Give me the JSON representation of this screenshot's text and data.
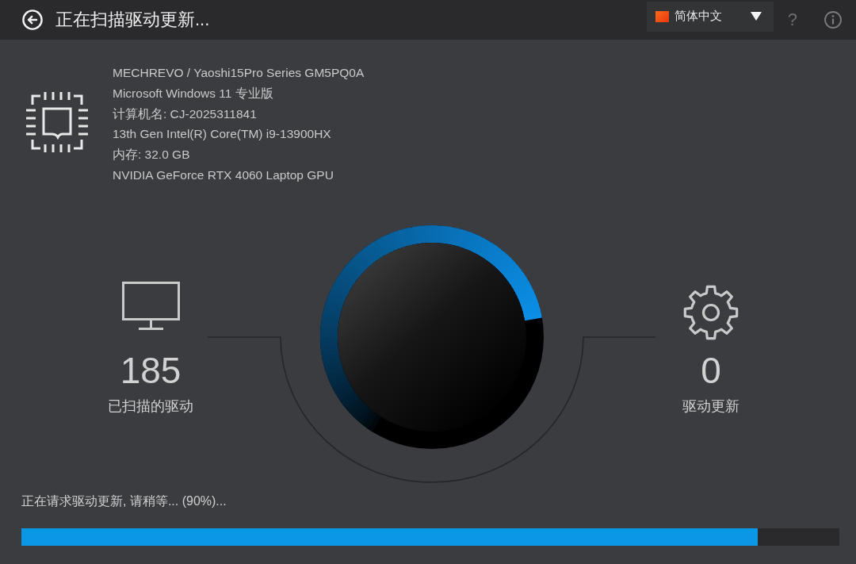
{
  "header": {
    "title": "正在扫描驱动更新...",
    "language": {
      "label": "简体中文"
    },
    "help": "?"
  },
  "system_info": {
    "model": "MECHREVO / Yaoshi15Pro Series GM5PQ0A",
    "os": "Microsoft Windows 11 专业版",
    "computer_name": "计算机名: CJ-2025311841",
    "processor": "13th Gen Intel(R) Core(TM) i9-13900HX",
    "memory": "内存: 32.0 GB",
    "graphics": "NVIDIA GeForce RTX 4060 Laptop GPU"
  },
  "stats": [
    {
      "kind": "scanned",
      "value": "185",
      "label": "已扫描的驱动"
    },
    {
      "kind": "updates",
      "value": "0",
      "label": "驱动更新"
    }
  ],
  "status": {
    "message": "正在请求驱动更新, 请稍等... (90%)...",
    "progress": {
      "level": 0.9
    }
  }
}
